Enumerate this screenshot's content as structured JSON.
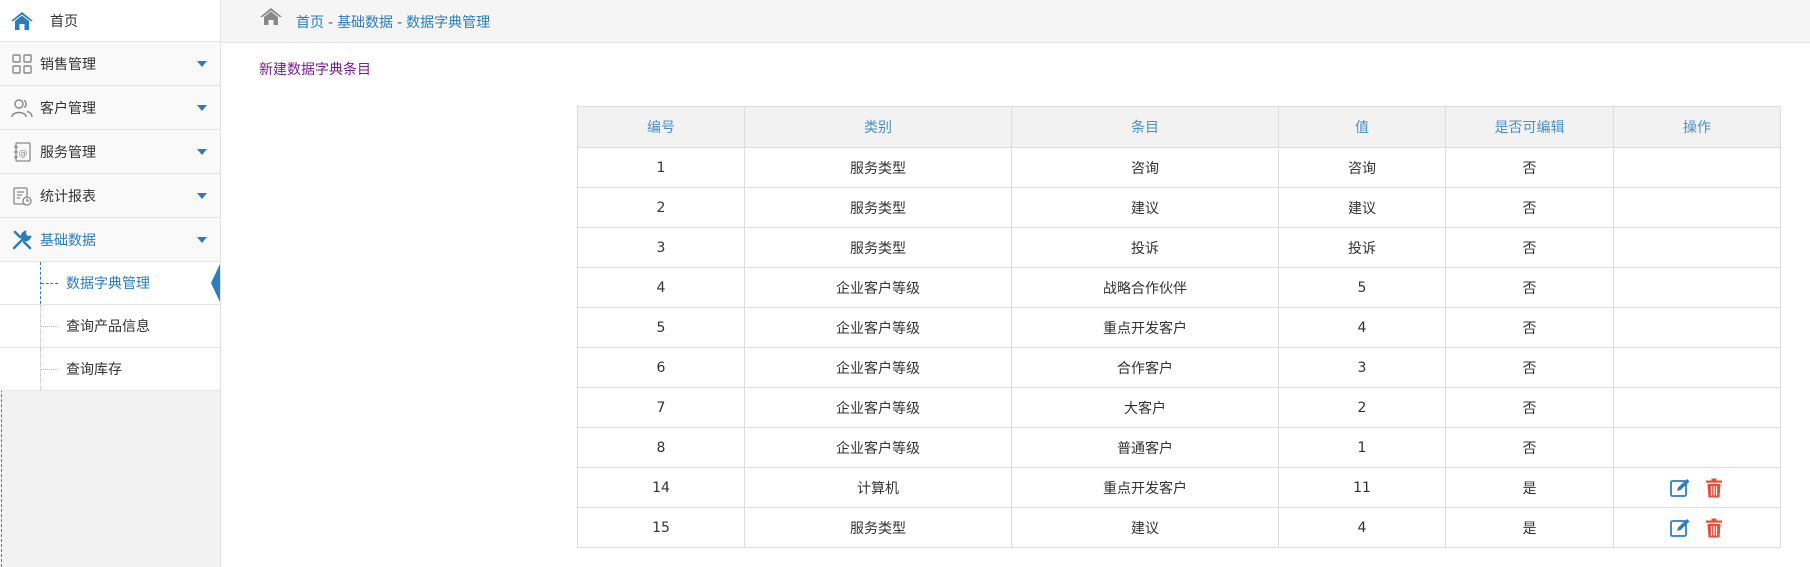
{
  "sidebar": {
    "home_label": "首页",
    "menus": [
      {
        "label": "销售管理",
        "icon": "grid-icon"
      },
      {
        "label": "客户管理",
        "icon": "users-icon"
      },
      {
        "label": "服务管理",
        "icon": "contact-book-icon"
      },
      {
        "label": "统计报表",
        "icon": "report-icon"
      },
      {
        "label": "基础数据",
        "icon": "wrench-icon"
      }
    ],
    "submenu": [
      {
        "label": "数据字典管理"
      },
      {
        "label": "查询产品信息"
      },
      {
        "label": "查询库存"
      }
    ]
  },
  "breadcrumb": {
    "items": [
      "首页",
      "基础数据",
      "数据字典管理"
    ],
    "separator": "-"
  },
  "actions": {
    "new_entry": "新建数据字典条目"
  },
  "table": {
    "headers": [
      "编号",
      "类别",
      "条目",
      "值",
      "是否可编辑",
      "操作"
    ],
    "rows": [
      {
        "id": "1",
        "category": "服务类型",
        "item": "咨询",
        "value": "咨询",
        "editable": "否"
      },
      {
        "id": "2",
        "category": "服务类型",
        "item": "建议",
        "value": "建议",
        "editable": "否"
      },
      {
        "id": "3",
        "category": "服务类型",
        "item": "投诉",
        "value": "投诉",
        "editable": "否"
      },
      {
        "id": "4",
        "category": "企业客户等级",
        "item": "战略合作伙伴",
        "value": "5",
        "editable": "否"
      },
      {
        "id": "5",
        "category": "企业客户等级",
        "item": "重点开发客户",
        "value": "4",
        "editable": "否"
      },
      {
        "id": "6",
        "category": "企业客户等级",
        "item": "合作客户",
        "value": "3",
        "editable": "否"
      },
      {
        "id": "7",
        "category": "企业客户等级",
        "item": "大客户",
        "value": "2",
        "editable": "否"
      },
      {
        "id": "8",
        "category": "企业客户等级",
        "item": "普通客户",
        "value": "1",
        "editable": "否"
      },
      {
        "id": "14",
        "category": "计算机",
        "item": "重点开发客户",
        "value": "11",
        "editable": "是"
      },
      {
        "id": "15",
        "category": "服务类型",
        "item": "建议",
        "value": "4",
        "editable": "是"
      }
    ]
  },
  "colors": {
    "accent": "#2b7dbc",
    "link_purple": "#7a1d8f",
    "edit_icon": "#2f7dc4",
    "delete_icon": "#e0503a"
  }
}
